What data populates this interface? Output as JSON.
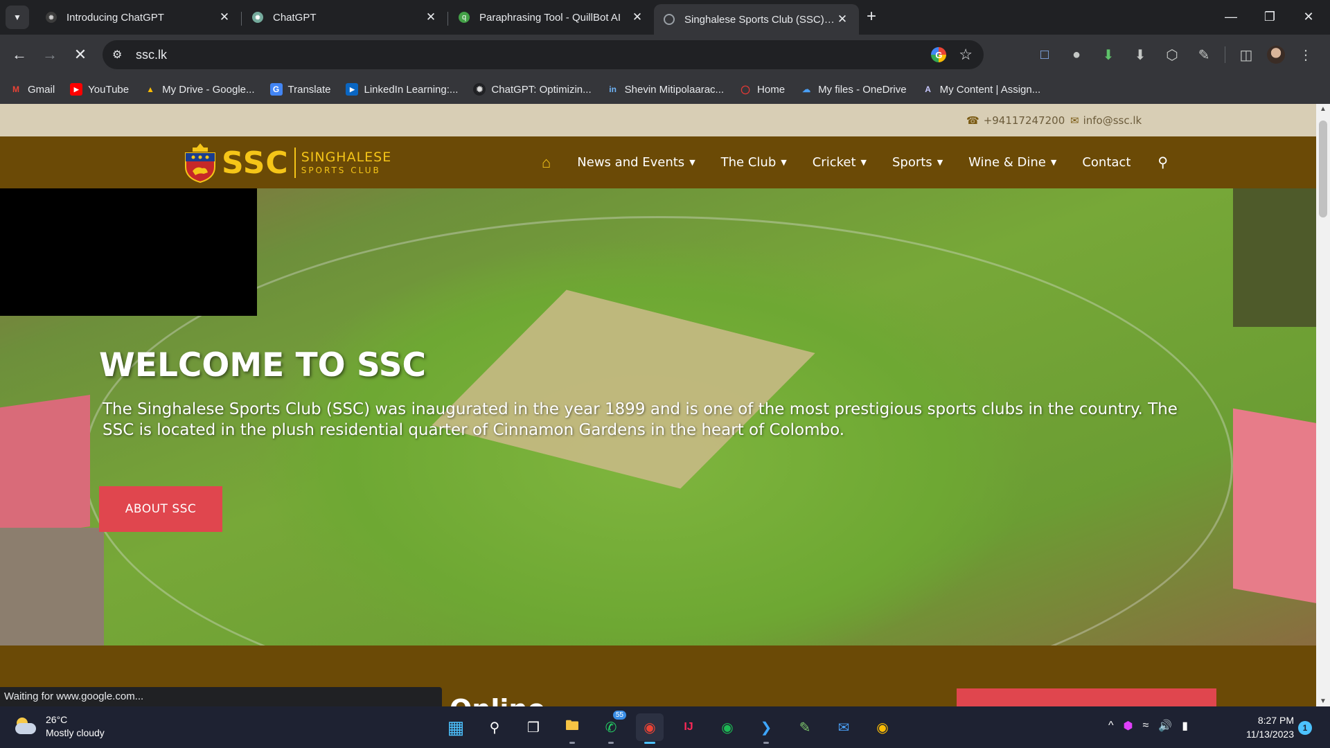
{
  "browser": {
    "tabs": [
      {
        "title": "Introducing ChatGPT",
        "active": false
      },
      {
        "title": "ChatGPT",
        "active": false
      },
      {
        "title": "Paraphrasing Tool - QuillBot AI",
        "active": false
      },
      {
        "title": "Singhalese Sports Club (SSC) - I",
        "active": true
      }
    ],
    "url": "ssc.lk",
    "bookmarks": [
      {
        "label": "Gmail",
        "icon": "gmail-icon"
      },
      {
        "label": "YouTube",
        "icon": "youtube-icon"
      },
      {
        "label": "My Drive - Google...",
        "icon": "google-drive-icon"
      },
      {
        "label": "Translate",
        "icon": "translate-icon"
      },
      {
        "label": "LinkedIn Learning:...",
        "icon": "linkedin-learning-icon"
      },
      {
        "label": "ChatGPT: Optimizin...",
        "icon": "chatgpt-icon"
      },
      {
        "label": "Shevin Mitipolaarac...",
        "icon": "linkedin-icon"
      },
      {
        "label": "Home",
        "icon": "home-icon"
      },
      {
        "label": "My files - OneDrive",
        "icon": "onedrive-icon"
      },
      {
        "label": "My Content | Assign...",
        "icon": "assignment-icon"
      }
    ],
    "status_text": "Waiting for www.google.com..."
  },
  "site": {
    "topbar": {
      "phone": "+94117247200",
      "email": "info@ssc.lk"
    },
    "logo": {
      "abbr": "SSC",
      "line1": "SINGHALESE",
      "line2": "SPORTS CLUB"
    },
    "nav": [
      {
        "label": "News and Events",
        "dropdown": true
      },
      {
        "label": "The Club",
        "dropdown": true
      },
      {
        "label": "Cricket",
        "dropdown": true
      },
      {
        "label": "Sports",
        "dropdown": true
      },
      {
        "label": "Wine & Dine",
        "dropdown": true
      },
      {
        "label": "Contact",
        "dropdown": false
      }
    ],
    "hero": {
      "title": "WELCOME TO SSC",
      "text": "The Singhalese Sports Club (SSC) was inaugurated in the year 1899 and is one of the most prestigious sports clubs in the country. The SSC is located in the plush residential quarter of Cinnamon Gardens in the heart of Colombo.",
      "button": "ABOUT SSC"
    },
    "lower_heading": "ons Online",
    "colors": {
      "brown": "#6b4a06",
      "gold": "#f5c518",
      "red": "#e0464e",
      "topbar": "#d8ceb5"
    }
  },
  "taskbar": {
    "weather_temp": "26°C",
    "weather_desc": "Mostly cloudy",
    "whatsapp_badge": "55",
    "time": "8:27 PM",
    "date": "11/13/2023",
    "notification_count": "1"
  }
}
